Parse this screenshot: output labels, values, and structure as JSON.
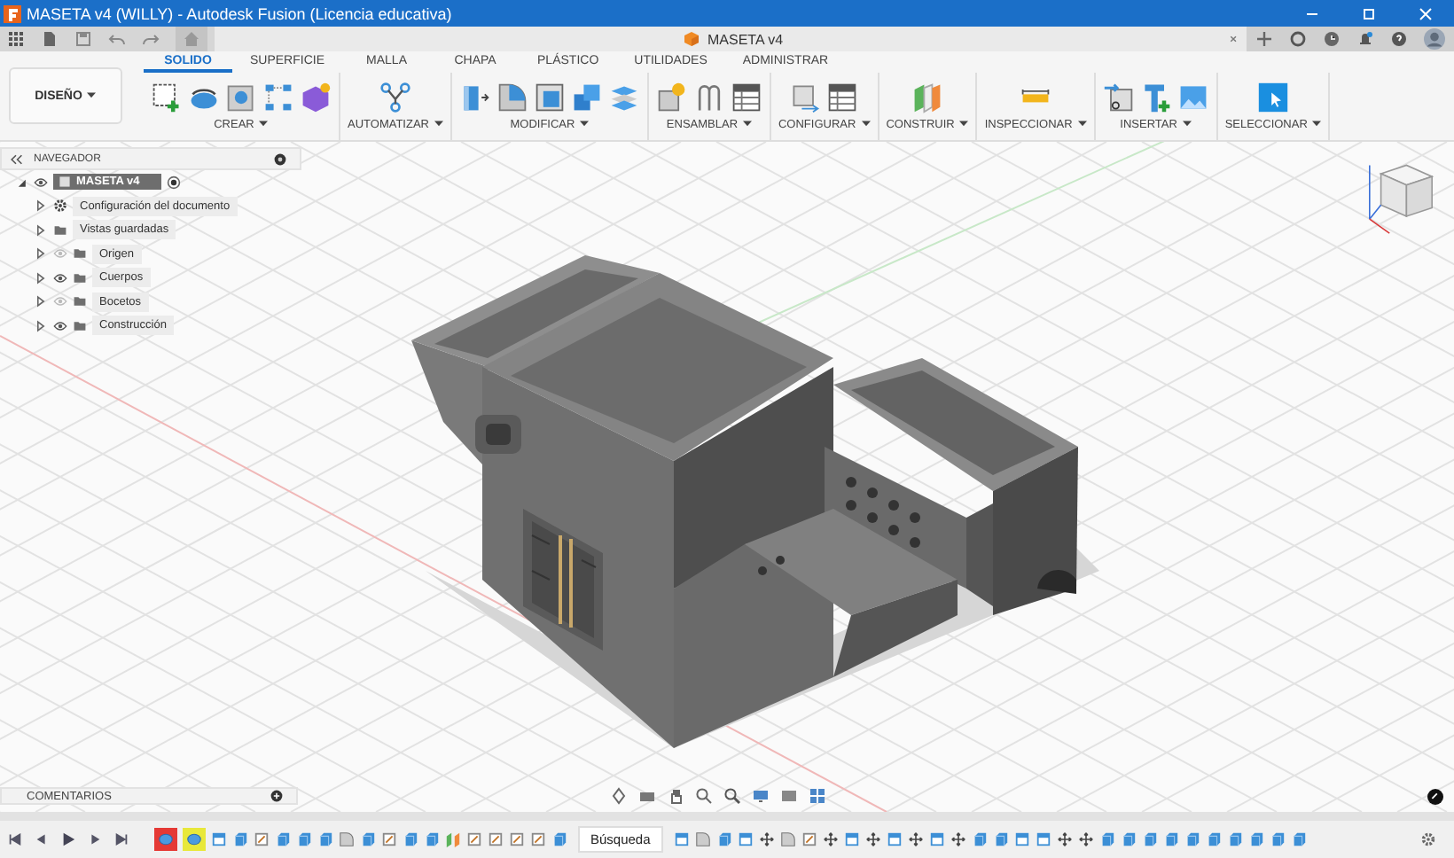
{
  "window": {
    "title": "MASETA v4 (WILLY) - Autodesk Fusion (Licencia educativa)"
  },
  "document_tab": {
    "title": "MASETA v4"
  },
  "workspace": {
    "label": "DISEÑO"
  },
  "toolbar_tabs": [
    {
      "label": "SOLIDO",
      "selected": true
    },
    {
      "label": "SUPERFICIE",
      "selected": false
    },
    {
      "label": "MALLA",
      "selected": false
    },
    {
      "label": "CHAPA",
      "selected": false
    },
    {
      "label": "PLÁSTICO",
      "selected": false
    },
    {
      "label": "UTILIDADES",
      "selected": false
    },
    {
      "label": "ADMINISTRAR",
      "selected": false
    }
  ],
  "tool_groups": [
    {
      "label": "CREAR",
      "tools": [
        {
          "kind": "sketch"
        },
        {
          "kind": "extrude"
        },
        {
          "kind": "hole"
        },
        {
          "kind": "pattern"
        },
        {
          "kind": "form"
        }
      ]
    },
    {
      "label": "AUTOMATIZAR",
      "tools": [
        {
          "kind": "automate"
        }
      ]
    },
    {
      "label": "MODIFICAR",
      "tools": [
        {
          "kind": "presspull"
        },
        {
          "kind": "fillet"
        },
        {
          "kind": "shell"
        },
        {
          "kind": "combine"
        },
        {
          "kind": "stack"
        }
      ]
    },
    {
      "label": "ENSAMBLAR",
      "tools": [
        {
          "kind": "component"
        },
        {
          "kind": "joint"
        },
        {
          "kind": "table"
        }
      ]
    },
    {
      "label": "CONFIGURAR",
      "tools": [
        {
          "kind": "cube"
        },
        {
          "kind": "table"
        }
      ]
    },
    {
      "label": "CONSTRUIR",
      "tools": [
        {
          "kind": "plane"
        }
      ]
    },
    {
      "label": "INSPECCIONAR",
      "tools": [
        {
          "kind": "measure"
        }
      ]
    },
    {
      "label": "INSERTAR",
      "tools": [
        {
          "kind": "derive"
        },
        {
          "kind": "insert"
        },
        {
          "kind": "image"
        }
      ]
    },
    {
      "label": "SELECCIONAR",
      "tools": [
        {
          "kind": "select"
        }
      ]
    }
  ],
  "navigator": {
    "title": "NAVEGADOR",
    "root": {
      "label": "MASETA v4",
      "visible": true
    },
    "items": [
      {
        "label": "Configuración del documento",
        "kind": "settings"
      },
      {
        "label": "Vistas guardadas",
        "kind": "folder"
      },
      {
        "label": "Origen",
        "kind": "folder",
        "visible": false
      },
      {
        "label": "Cuerpos",
        "kind": "folder",
        "visible": true
      },
      {
        "label": "Bocetos",
        "kind": "folder",
        "visible": false
      },
      {
        "label": "Construcción",
        "kind": "folder",
        "visible": true
      }
    ]
  },
  "comments": {
    "title": "COMENTARIOS"
  },
  "timeline": {
    "tooltip": "Búsqueda",
    "features": [
      {
        "kind": "body",
        "color": "#e53935"
      },
      {
        "kind": "body",
        "color": "#e8e83a"
      },
      {
        "kind": "window"
      },
      {
        "kind": "extrude"
      },
      {
        "kind": "sketch"
      },
      {
        "kind": "extrude"
      },
      {
        "kind": "extrude"
      },
      {
        "kind": "extrude"
      },
      {
        "kind": "fillet"
      },
      {
        "kind": "extrude"
      },
      {
        "kind": "sketch"
      },
      {
        "kind": "extrude"
      },
      {
        "kind": "extrude"
      },
      {
        "kind": "plane"
      },
      {
        "kind": "sketch"
      },
      {
        "kind": "sketch"
      },
      {
        "kind": "sketch"
      },
      {
        "kind": "sketch"
      },
      {
        "kind": "extrude"
      },
      {
        "kind": "window"
      },
      {
        "kind": "fillet"
      },
      {
        "kind": "extrude"
      },
      {
        "kind": "window"
      },
      {
        "kind": "move"
      },
      {
        "kind": "fillet"
      },
      {
        "kind": "sketch"
      },
      {
        "kind": "move"
      },
      {
        "kind": "window"
      },
      {
        "kind": "move"
      },
      {
        "kind": "window"
      },
      {
        "kind": "move"
      },
      {
        "kind": "window"
      },
      {
        "kind": "move"
      },
      {
        "kind": "extrude"
      },
      {
        "kind": "extrude"
      },
      {
        "kind": "window"
      },
      {
        "kind": "window"
      },
      {
        "kind": "move"
      },
      {
        "kind": "move"
      },
      {
        "kind": "extrude"
      },
      {
        "kind": "extrude"
      },
      {
        "kind": "extrude"
      },
      {
        "kind": "extrude"
      },
      {
        "kind": "extrude"
      },
      {
        "kind": "extrude"
      },
      {
        "kind": "extrude"
      },
      {
        "kind": "extrude"
      },
      {
        "kind": "extrude"
      },
      {
        "kind": "extrude"
      }
    ]
  }
}
